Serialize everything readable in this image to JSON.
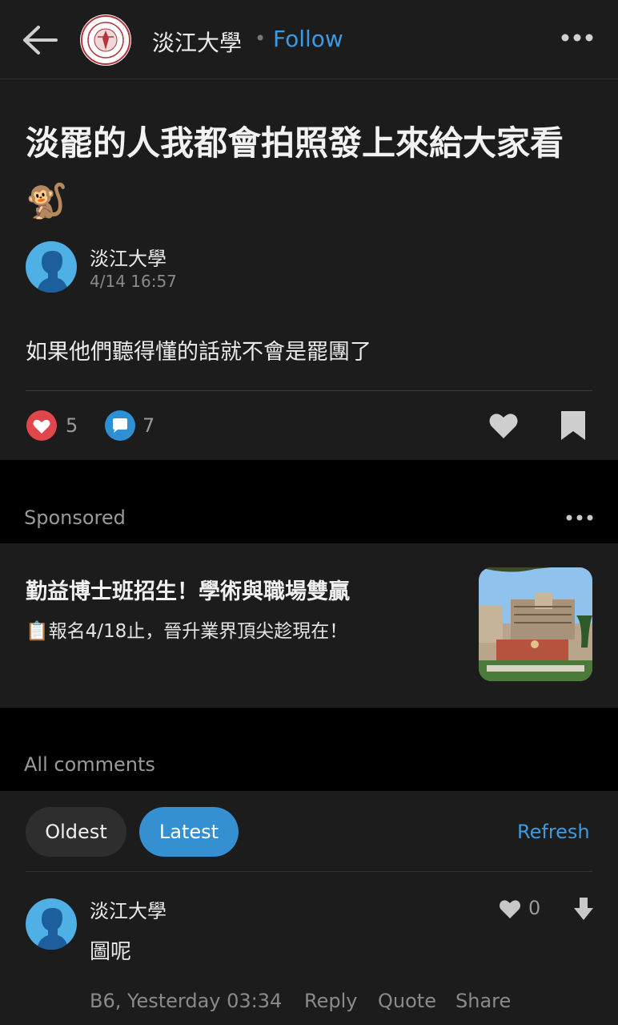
{
  "header": {
    "board_name": "淡江大學",
    "separator": "•",
    "follow_label": "Follow"
  },
  "post": {
    "title": "淡罷的人我都會拍照發上來給大家看🐒",
    "author": "淡江大學",
    "time": "4/14 16:57",
    "body": "如果他們聽得懂的話就不會是罷團了",
    "like_count": "5",
    "comment_count": "7"
  },
  "sponsored": {
    "label": "Sponsored",
    "ad_title": "勤益博士班招生！學術與職場雙贏",
    "ad_subtitle": "📋報名4/18止，晉升業界頂尖趁現在！"
  },
  "comments": {
    "section_label": "All comments",
    "sort_oldest": "Oldest",
    "sort_latest": "Latest",
    "sort_selected": "Latest",
    "refresh_label": "Refresh",
    "items": [
      {
        "author": "淡江大學",
        "text": "圖呢",
        "like_count": "0",
        "meta": "B6, Yesterday 03:34",
        "reply_label": "Reply",
        "quote_label": "Quote",
        "share_label": "Share"
      }
    ]
  },
  "colors": {
    "accent": "#3d9ae0",
    "like_red": "#e0474c",
    "comment_blue": "#2f8fd3",
    "panel_bg": "#1c1c1c",
    "page_bg": "#000000"
  },
  "icons": [
    "back-arrow-icon",
    "more-icon",
    "heart-icon",
    "comment-icon",
    "bookmark-icon",
    "like-outline-icon",
    "downvote-icon"
  ]
}
